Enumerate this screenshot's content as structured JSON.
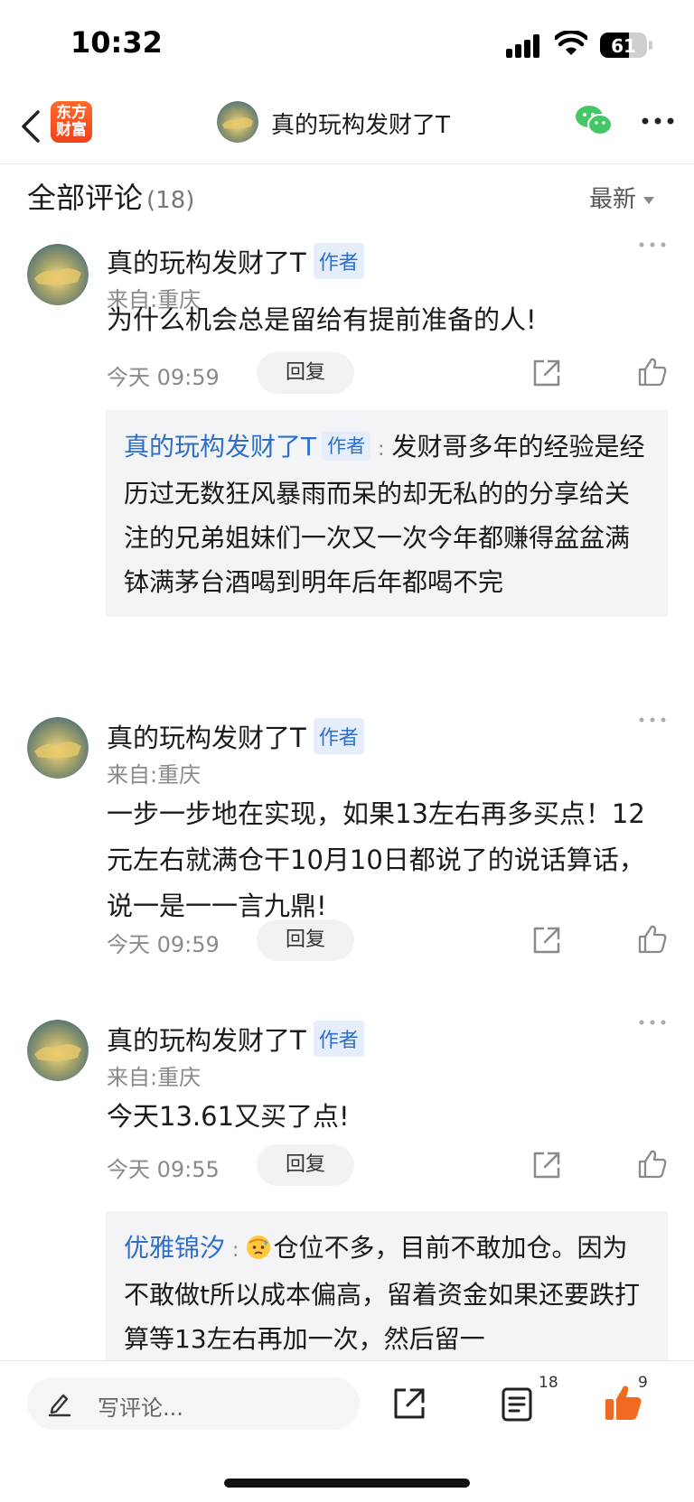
{
  "status_bar": {
    "time": "10:32",
    "battery": "61"
  },
  "nav": {
    "app_logo": "东方财富",
    "title": "真的玩构发财了T"
  },
  "comments_header": {
    "title": "全部评论",
    "count": "(18)",
    "sort": "最新"
  },
  "comments": [
    {
      "author": "真的玩构发财了T",
      "badge": "作者",
      "location": "来自:重庆",
      "text": "为什么机会总是留给有提前准备的人!",
      "time": "今天 09:59",
      "reply_label": "回复",
      "reply": {
        "author": "真的玩构发财了T",
        "badge": "作者",
        "separator": ":",
        "text": "发财哥多年的经验是经历过无数狂风暴雨而呆的却无私的的分享给关注的兄弟姐妹们一次又一次今年都赚得盆盆满钵满茅台酒喝到明年后年都喝不完"
      }
    },
    {
      "author": "真的玩构发财了T",
      "badge": "作者",
      "location": "来自:重庆",
      "text": "一步一步地在实现，如果13左右再多买点！12元左右就满仓干10月10日都说了的说话算话，说一是一一言九鼎!",
      "time": "今天 09:59",
      "reply_label": "回复"
    },
    {
      "author": "真的玩构发财了T",
      "badge": "作者",
      "location": "来自:重庆",
      "text": "今天13.61又买了点!",
      "time": "今天 09:55",
      "reply_label": "回复",
      "reply": {
        "author": "优雅锦汐",
        "separator": ":",
        "text": "仓位不多，目前不敢加仓。因为不敢做t所以成本偏高，留着资金如果还要跌打算等13左右再加一次，然后留一"
      }
    }
  ],
  "bottom_bar": {
    "placeholder": "写评论...",
    "comments_count": "18",
    "likes_count": "9"
  },
  "colors": {
    "accent_blue": "#2d6fc9",
    "like_orange": "#f26a21",
    "brand_orange": "#f0421c"
  }
}
